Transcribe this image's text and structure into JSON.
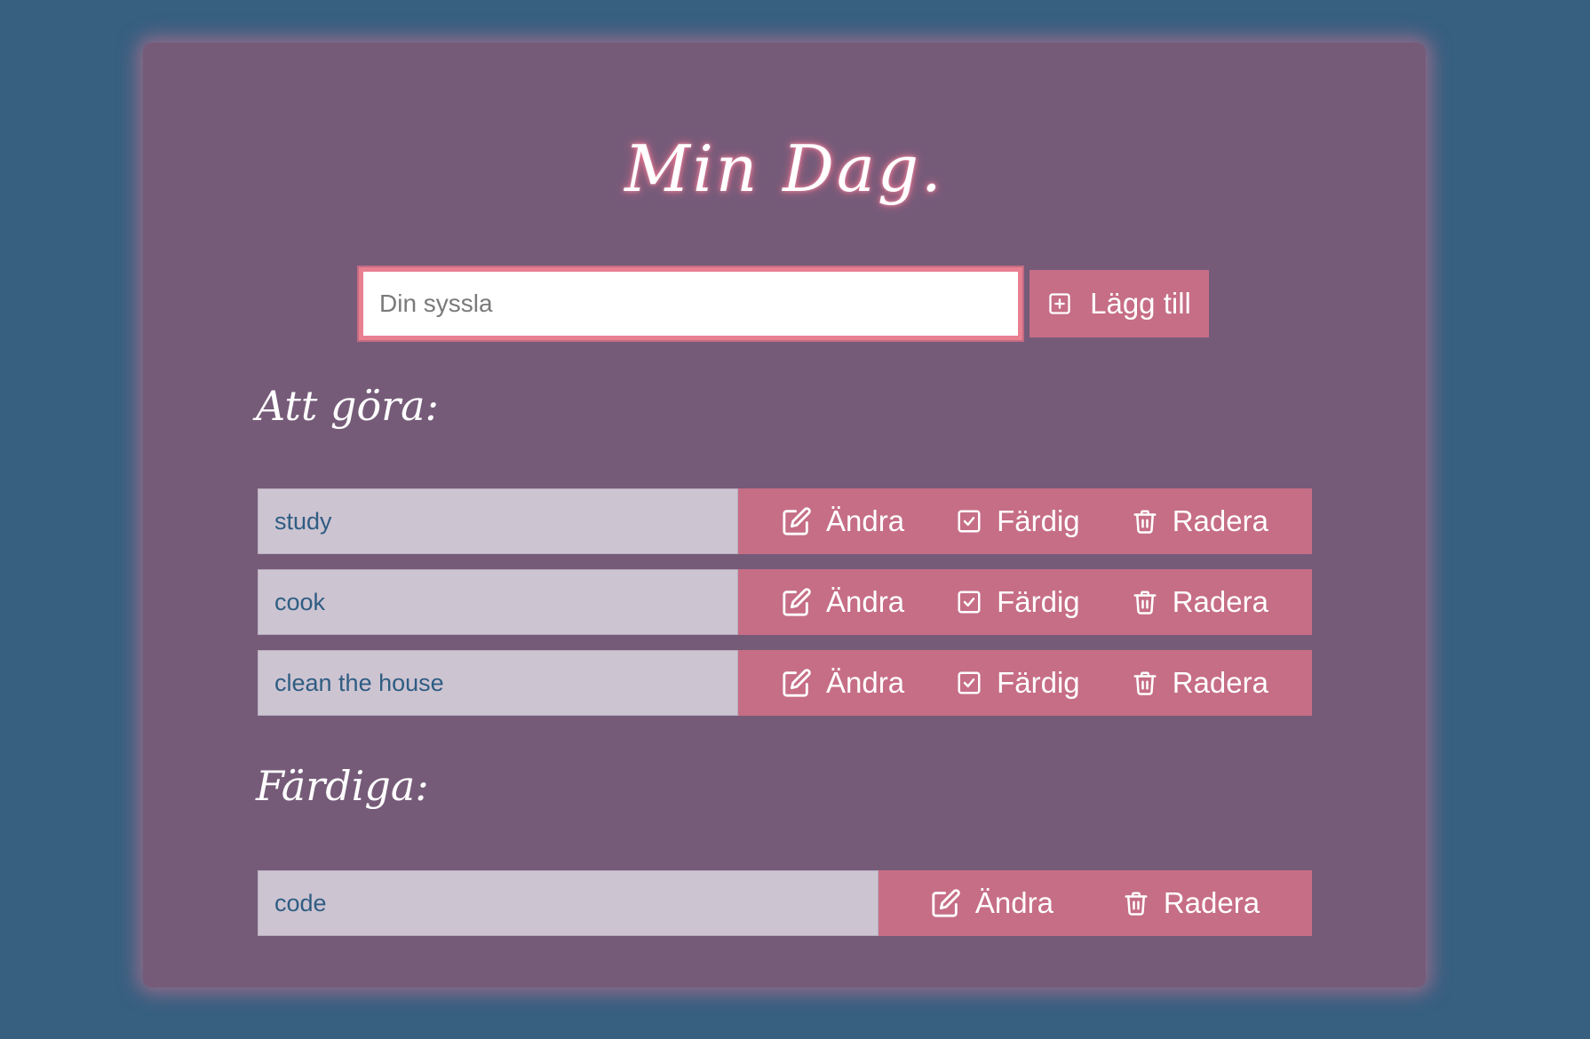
{
  "app": {
    "title": "Min Dag."
  },
  "add_form": {
    "input_placeholder": "Din syssla",
    "input_value": "",
    "add_label": "Lägg till",
    "add_icon": "plus-square-icon"
  },
  "todo": {
    "heading": "Att göra:",
    "items": [
      {
        "text": "study",
        "edit_label": "Ändra",
        "done_label": "Färdig",
        "delete_label": "Radera"
      },
      {
        "text": "cook",
        "edit_label": "Ändra",
        "done_label": "Färdig",
        "delete_label": "Radera"
      },
      {
        "text": "clean the house",
        "edit_label": "Ändra",
        "done_label": "Färdig",
        "delete_label": "Radera"
      }
    ]
  },
  "done": {
    "heading": "Färdiga:",
    "items": [
      {
        "text": "code",
        "edit_label": "Ändra",
        "delete_label": "Radera"
      }
    ]
  },
  "icons": {
    "edit": "pencil-square-icon",
    "done": "check-square-icon",
    "delete": "trash-icon"
  },
  "colors": {
    "page_background": "#375f80",
    "card_background": "#765b79",
    "accent": "#c66e86",
    "item_background": "#cdc4d2",
    "item_text": "#2f5d82",
    "glow": "#f06a8a"
  }
}
